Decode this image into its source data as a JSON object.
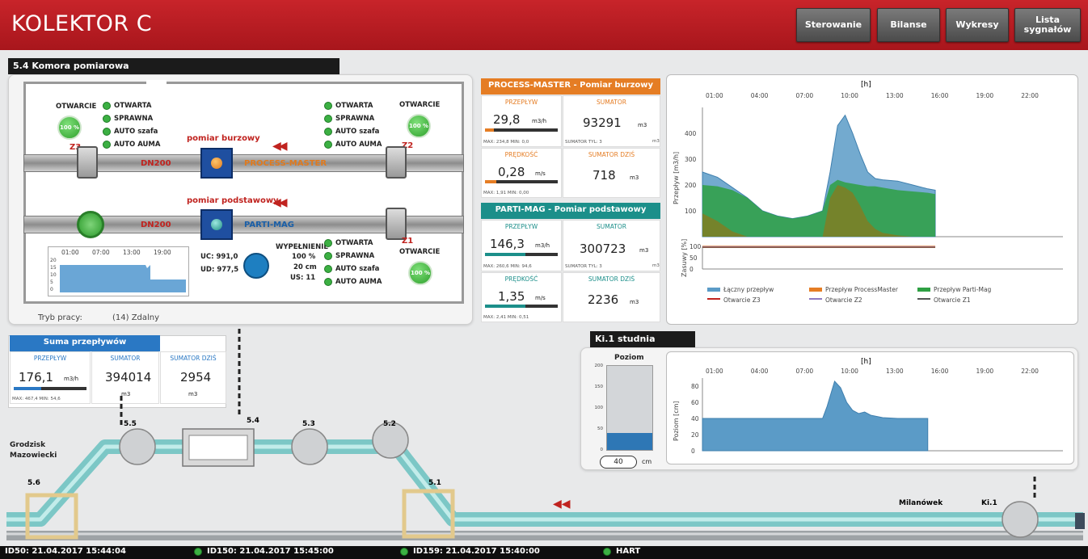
{
  "header": {
    "title": "KOLEKTOR C",
    "buttons": [
      "Sterowanie",
      "Bilanse",
      "Wykresy",
      "Lista sygnałów"
    ]
  },
  "komora": {
    "section_title": "5.4 Komora pomiarowa",
    "left_valve": {
      "label": "OTWARCIE",
      "percent": "100 %",
      "signals": [
        "OTWARTA",
        "SPRAWNA",
        "AUTO szafa",
        "AUTO AUMA"
      ],
      "id": "Z3"
    },
    "right_top_valve": {
      "label": "OTWARCIE",
      "percent": "100 %",
      "signals": [
        "OTWARTA",
        "SPRAWNA",
        "AUTO szafa",
        "AUTO AUMA"
      ],
      "id": "Z2"
    },
    "right_bottom_valve": {
      "label": "OTWARCIE",
      "percent": "100 %",
      "signals": [
        "OTWARTA",
        "SPRAWNA",
        "AUTO szafa",
        "AUTO AUMA"
      ],
      "id": "Z1"
    },
    "pipe_top": {
      "dn": "DN200",
      "meter_label": "pomiar burzowy",
      "meter_name": "PROCESS-MASTER"
    },
    "pipe_bottom": {
      "dn": "DN200",
      "meter_label": "pomiar podstawowy",
      "meter_name": "PARTI-MAG"
    },
    "mini_chart_ticks": [
      "01:00",
      "07:00",
      "13:00",
      "19:00"
    ],
    "mini_chart_y": [
      "20",
      "15",
      "10",
      "5",
      "0"
    ],
    "uc": "UC: 991,0",
    "ud": "UD: 977,5",
    "wypelnienie": {
      "label": "WYPEŁNIENIE",
      "percent": "100 %",
      "cm": "20 cm",
      "us": "US: 11"
    },
    "tryb_label": "Tryb pracy:",
    "tryb_value": "(14) Zdalny"
  },
  "process_master": {
    "title": "PROCESS-MASTER - Pomiar burzowy",
    "przeplyw_cap": "PRZEPŁYW",
    "przeplyw_val": "29,8",
    "przeplyw_unit": "m3/h",
    "przeplyw_fill": 0.12,
    "przeplyw_mm": "MAX: 234,8    MIN: 0,0",
    "sumator_cap": "SUMATOR",
    "sumator_val": "93291",
    "sumator_unit": "m3",
    "sumator_tyl": "SUMATOR TYL:  3",
    "sumator_tyl_unit": "m3",
    "predkosc_cap": "PRĘDKOŚĆ",
    "predkosc_val": "0,28",
    "predkosc_unit": "m/s",
    "predkosc_fill": 0.15,
    "predkosc_mm": "MAX: 1,91    MIN: 0,00",
    "dzis_cap": "SUMATOR DZIŚ",
    "dzis_val": "718",
    "dzis_unit": "m3"
  },
  "parti_mag": {
    "title": "PARTI-MAG - Pomiar podstawowy",
    "przeplyw_cap": "PRZEPŁYW",
    "przeplyw_val": "146,3",
    "przeplyw_unit": "m3/h",
    "przeplyw_fill": 0.55,
    "przeplyw_mm": "MAX: 260,6    MIN: 94,6",
    "sumator_cap": "SUMATOR",
    "sumator_val": "300723",
    "sumator_unit": "m3",
    "sumator_tyl": "SUMATOR TYL:  3",
    "sumator_tyl_unit": "m3",
    "predkosc_cap": "PRĘDKOŚĆ",
    "predkosc_val": "1,35",
    "predkosc_unit": "m/s",
    "predkosc_fill": 0.56,
    "predkosc_mm": "MAX: 2,41    MIN: 0,51",
    "dzis_cap": "SUMATOR DZIŚ",
    "dzis_val": "2236",
    "dzis_unit": "m3"
  },
  "suma": {
    "title": "Suma przepływów",
    "przeplyw_cap": "PRZEPŁYW",
    "przeplyw_val": "176,1",
    "przeplyw_unit": "m3/h",
    "przeplyw_fill": 0.38,
    "przeplyw_mm": "MAX: 467,4    MIN: 54,6",
    "sumator_cap": "SUMATOR",
    "sumator_val": "394014",
    "sumator_unit": "m3",
    "dzis_cap": "SUMATOR DZIŚ",
    "dzis_val": "2954",
    "dzis_unit": "m3"
  },
  "studnia": {
    "title": "Ki.1 studnia",
    "poziom_label": "Poziom",
    "scale": [
      "200",
      "150",
      "100",
      "50",
      "0"
    ],
    "level_fraction": 0.2,
    "value": "40",
    "unit": "cm"
  },
  "network": {
    "node_55": "5.5",
    "node_54": "5.4",
    "node_53": "5.3",
    "node_52": "5.2",
    "node_56": "5.6",
    "node_51": "5.1",
    "city_left": "Grodzisk Mazowiecki",
    "city_right": "Milanówek",
    "ki1": "Ki.1"
  },
  "footer": {
    "items": [
      "ID50:  21.04.2017 15:44:04",
      "ID150:  21.04.2017 15:45:00",
      "ID159:  21.04.2017 15:40:00",
      "HART"
    ]
  },
  "colors": {
    "header_red": "#b81c22",
    "blue_area": "#5b9bc7",
    "green_area": "#2ea043",
    "olive_area": "#8a7a1c",
    "green_dot": "#3cb043"
  },
  "chart_data": [
    {
      "type": "area",
      "xlabel": "[h]",
      "ylabel": "Przepływ [m3/h]",
      "x_ticks": [
        "01:00",
        "04:00",
        "07:00",
        "10:00",
        "13:00",
        "16:00",
        "19:00",
        "22:00"
      ],
      "ylim": [
        0,
        500
      ],
      "y_ticks": [
        100,
        200,
        300,
        400
      ],
      "x": [
        0,
        1,
        2,
        3,
        4,
        5,
        6,
        7,
        8,
        8.5,
        9,
        9.5,
        10,
        10.5,
        11,
        11.5,
        12,
        13,
        14,
        15,
        15.5
      ],
      "series": [
        {
          "name": "Łączny przepływ",
          "values": [
            250,
            230,
            190,
            150,
            100,
            80,
            70,
            80,
            100,
            250,
            430,
            470,
            400,
            320,
            250,
            225,
            220,
            215,
            200,
            185,
            180
          ]
        },
        {
          "name": "Przepływ Parti-Mag",
          "values": [
            200,
            195,
            180,
            150,
            100,
            80,
            70,
            80,
            100,
            200,
            220,
            210,
            205,
            200,
            195,
            195,
            190,
            180,
            175,
            170,
            165
          ]
        },
        {
          "name": "Przepływ ProcessMaster",
          "values": [
            90,
            60,
            20,
            0,
            0,
            0,
            0,
            0,
            0,
            150,
            200,
            190,
            170,
            120,
            60,
            30,
            15,
            5,
            0,
            0,
            0
          ]
        }
      ],
      "zasuwy": {
        "ylabel": "Zasuwy [%]",
        "ylim": [
          0,
          100
        ],
        "y_ticks": [
          0,
          50,
          100
        ],
        "series": [
          {
            "name": "Otwarcie Z3",
            "value": 100
          },
          {
            "name": "Otwarcie Z2",
            "value": 100
          },
          {
            "name": "Otwarcie Z1",
            "value": 100
          }
        ]
      },
      "legend": [
        "Łączny przepływ",
        "Przepływ ProcessMaster",
        "Przepływ Parti-Mag",
        "Otwarcie Z3",
        "Otwarcie Z2",
        "Otwarcie Z1"
      ]
    },
    {
      "type": "area",
      "xlabel": "[h]",
      "ylabel": "Poziom [cm]",
      "x_ticks": [
        "01:00",
        "04:00",
        "07:00",
        "10:00",
        "13:00",
        "16:00",
        "19:00",
        "22:00"
      ],
      "ylim": [
        0,
        90
      ],
      "y_ticks": [
        0,
        20,
        40,
        60,
        80
      ],
      "x": [
        0,
        1,
        2,
        3,
        4,
        5,
        6,
        7,
        8,
        8.3,
        8.8,
        9.2,
        9.6,
        10,
        10.4,
        10.8,
        11.2,
        12,
        13,
        14,
        15
      ],
      "series": [
        {
          "name": "Poziom",
          "values": [
            40,
            40,
            40,
            40,
            40,
            40,
            40,
            40,
            40,
            55,
            86,
            78,
            60,
            50,
            46,
            48,
            44,
            41,
            40,
            40,
            40
          ]
        }
      ]
    }
  ]
}
